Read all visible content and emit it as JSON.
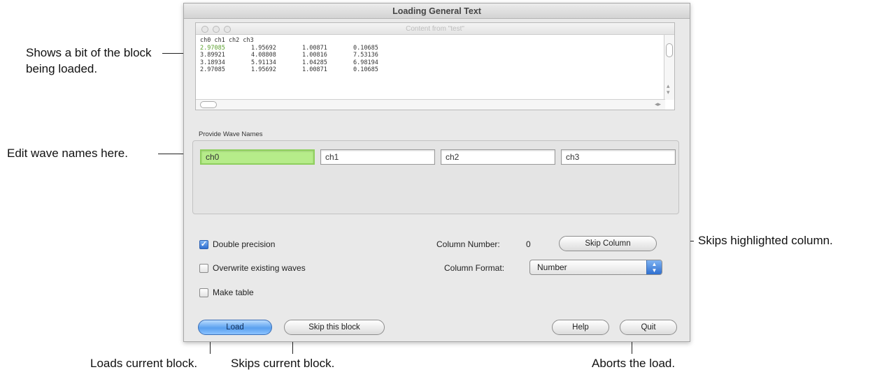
{
  "window": {
    "title": "Loading General Text"
  },
  "preview": {
    "title": "Content from \"test\"",
    "header": "ch0 ch1 ch2 ch3",
    "rows": [
      [
        "2.97085",
        "1.95692",
        "1.00871",
        "0.10685"
      ],
      [
        "3.89921",
        "4.08808",
        "1.00816",
        "7.53136"
      ],
      [
        "3.18934",
        "5.91134",
        "1.04285",
        "6.98194"
      ],
      [
        "2.97085",
        "1.95692",
        "1.00871",
        "0.10685"
      ]
    ]
  },
  "waves": {
    "group_label": "Provide Wave Names",
    "names": [
      "ch0",
      "ch1",
      "ch2",
      "ch3"
    ],
    "selected_index": 0
  },
  "options": {
    "double_precision": {
      "label": "Double precision",
      "checked": true
    },
    "overwrite": {
      "label": "Overwrite existing waves",
      "checked": false
    },
    "make_table": {
      "label": "Make table",
      "checked": false
    }
  },
  "column": {
    "number_label": "Column Number:",
    "number_value": "0",
    "skip_label": "Skip Column",
    "format_label": "Column Format:",
    "format_value": "Number"
  },
  "buttons": {
    "load": "Load",
    "skip_block": "Skip this block",
    "help": "Help",
    "quit": "Quit"
  },
  "annotations": {
    "preview_note_1": "Shows a bit of the block",
    "preview_note_2": "being loaded.",
    "wave_note": "Edit wave names here.",
    "skip_col_note": "Skips highlighted column.",
    "load_note": "Loads current block.",
    "skip_block_note": "Skips current block.",
    "quit_note": "Aborts the load."
  }
}
